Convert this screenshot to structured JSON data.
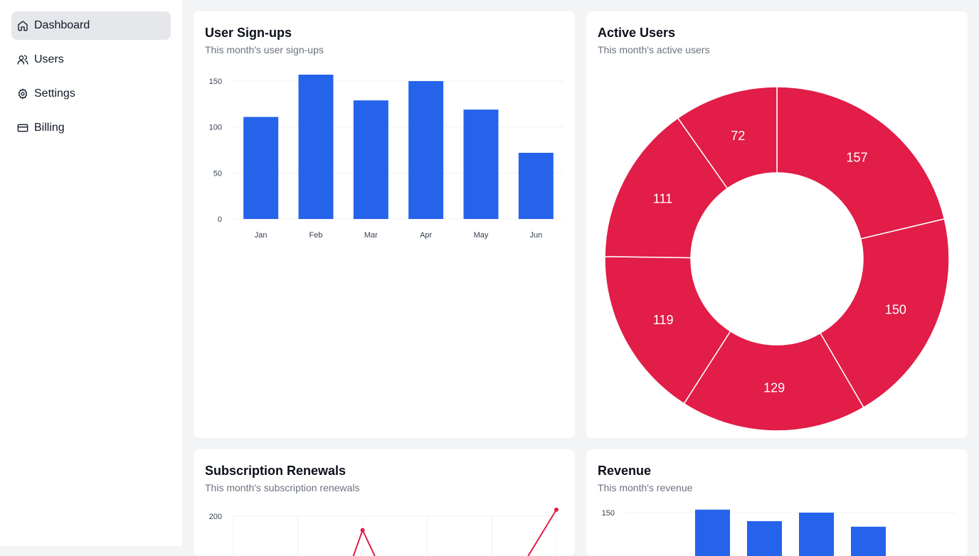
{
  "sidebar": {
    "items": [
      {
        "label": "Dashboard",
        "icon": "home-icon",
        "active": true
      },
      {
        "label": "Users",
        "icon": "users-icon",
        "active": false
      },
      {
        "label": "Settings",
        "icon": "gear-icon",
        "active": false
      },
      {
        "label": "Billing",
        "icon": "credit-card-icon",
        "active": false
      }
    ]
  },
  "cards": {
    "signups": {
      "title": "User Sign-ups",
      "subtitle": "This month's user sign-ups"
    },
    "active": {
      "title": "Active Users",
      "subtitle": "This month's active users"
    },
    "renewals": {
      "title": "Subscription Renewals",
      "subtitle": "This month's subscription renewals"
    },
    "revenue": {
      "title": "Revenue",
      "subtitle": "This month's revenue"
    }
  },
  "colors": {
    "blue": "#2563eb",
    "red": "#e11d48"
  },
  "chart_data": [
    {
      "id": "signups",
      "type": "bar",
      "categories": [
        "Jan",
        "Feb",
        "Mar",
        "Apr",
        "May",
        "Jun"
      ],
      "values": [
        111,
        157,
        129,
        150,
        119,
        72
      ],
      "yticks": [
        0,
        50,
        100,
        150
      ],
      "ylim": [
        0,
        157
      ],
      "grid": true,
      "color": "#2563eb"
    },
    {
      "id": "active",
      "type": "pie",
      "donut": true,
      "labels": [
        "157",
        "150",
        "129",
        "119",
        "111",
        "72"
      ],
      "values": [
        157,
        150,
        129,
        119,
        111,
        72
      ],
      "color": "#e11d48"
    },
    {
      "id": "renewals",
      "type": "line",
      "yticks": [
        200
      ],
      "x": [
        0,
        1,
        2,
        3,
        4,
        5
      ],
      "values": [
        null,
        null,
        172,
        null,
        null,
        213
      ],
      "color": "#e11d48",
      "grid": true
    },
    {
      "id": "revenue",
      "type": "bar",
      "yticks": [
        150
      ],
      "values": [
        null,
        157,
        130,
        150,
        117,
        null
      ],
      "color": "#2563eb",
      "grid": true
    }
  ]
}
